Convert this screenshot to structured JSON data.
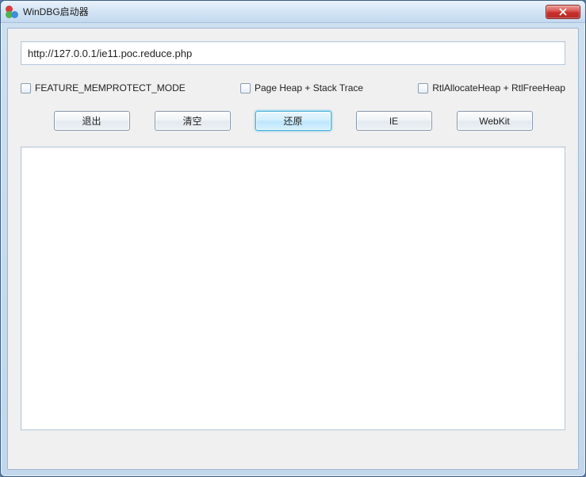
{
  "window": {
    "title": "WinDBG启动器"
  },
  "url_input": {
    "value": "http://127.0.0.1/ie11.poc.reduce.php"
  },
  "checkboxes": {
    "memprotect": {
      "label": "FEATURE_MEMPROTECT_MODE",
      "checked": false
    },
    "pageheap": {
      "label": "Page Heap + Stack Trace",
      "checked": false
    },
    "rtlheap": {
      "label": "RtlAllocateHeap + RtlFreeHeap",
      "checked": false
    }
  },
  "buttons": {
    "exit": "退出",
    "clear": "清空",
    "restore": "还原",
    "ie": "IE",
    "webkit": "WebKit"
  },
  "output": {
    "text": ""
  }
}
